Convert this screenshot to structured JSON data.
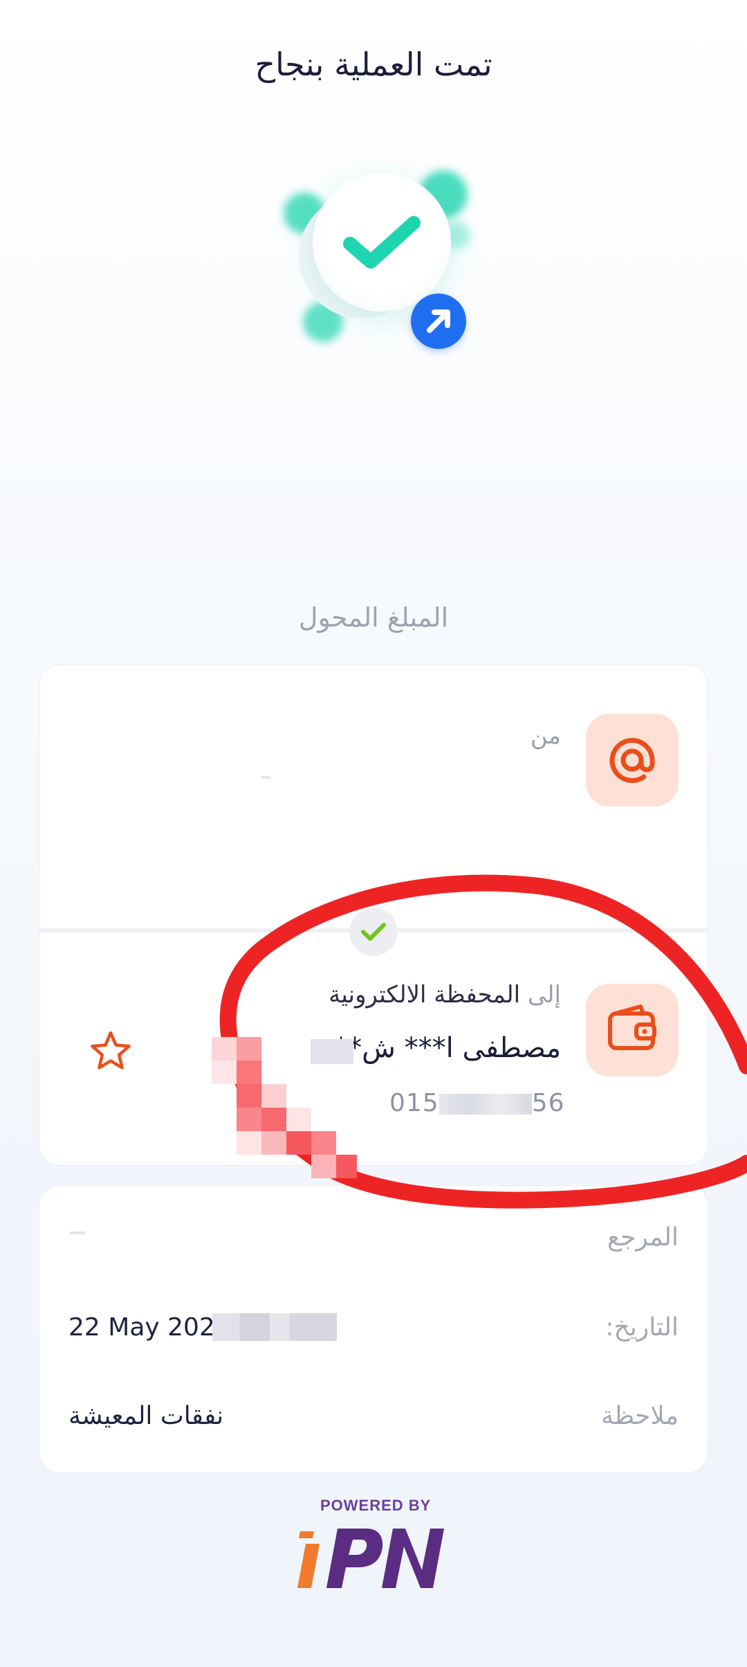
{
  "header": {
    "title": "تمت العملية بنجاح"
  },
  "transfer": {
    "amount_label": "المبلغ المحول",
    "from_label": "من",
    "to_label": "إلى",
    "wallet_type": "المحفظة الالكترونية",
    "recipient_name": "مصطفى ا*** ش**",
    "recipient_phone_start": "015",
    "recipient_phone_end": "56"
  },
  "details": {
    "reference_label": "المرجع",
    "date_label": "التاريخ:",
    "date_value": "22 May 202",
    "note_label": "ملاحظة",
    "note_value": "نفقات المعيشة"
  },
  "footer": {
    "powered_by": "POWERED BY"
  },
  "icons": {
    "success": "check-icon",
    "direction": "arrow-up-right-icon",
    "from": "at-sign-icon",
    "to": "wallet-icon",
    "favorite": "star-icon"
  },
  "colors": {
    "success": "#1fd5b0",
    "accent_blue": "#1f6ef0",
    "accent_orange": "#ea4e1b",
    "annotation_red": "#ee2424",
    "logo_purple": "#5a2d82",
    "logo_orange": "#f07b2c"
  }
}
